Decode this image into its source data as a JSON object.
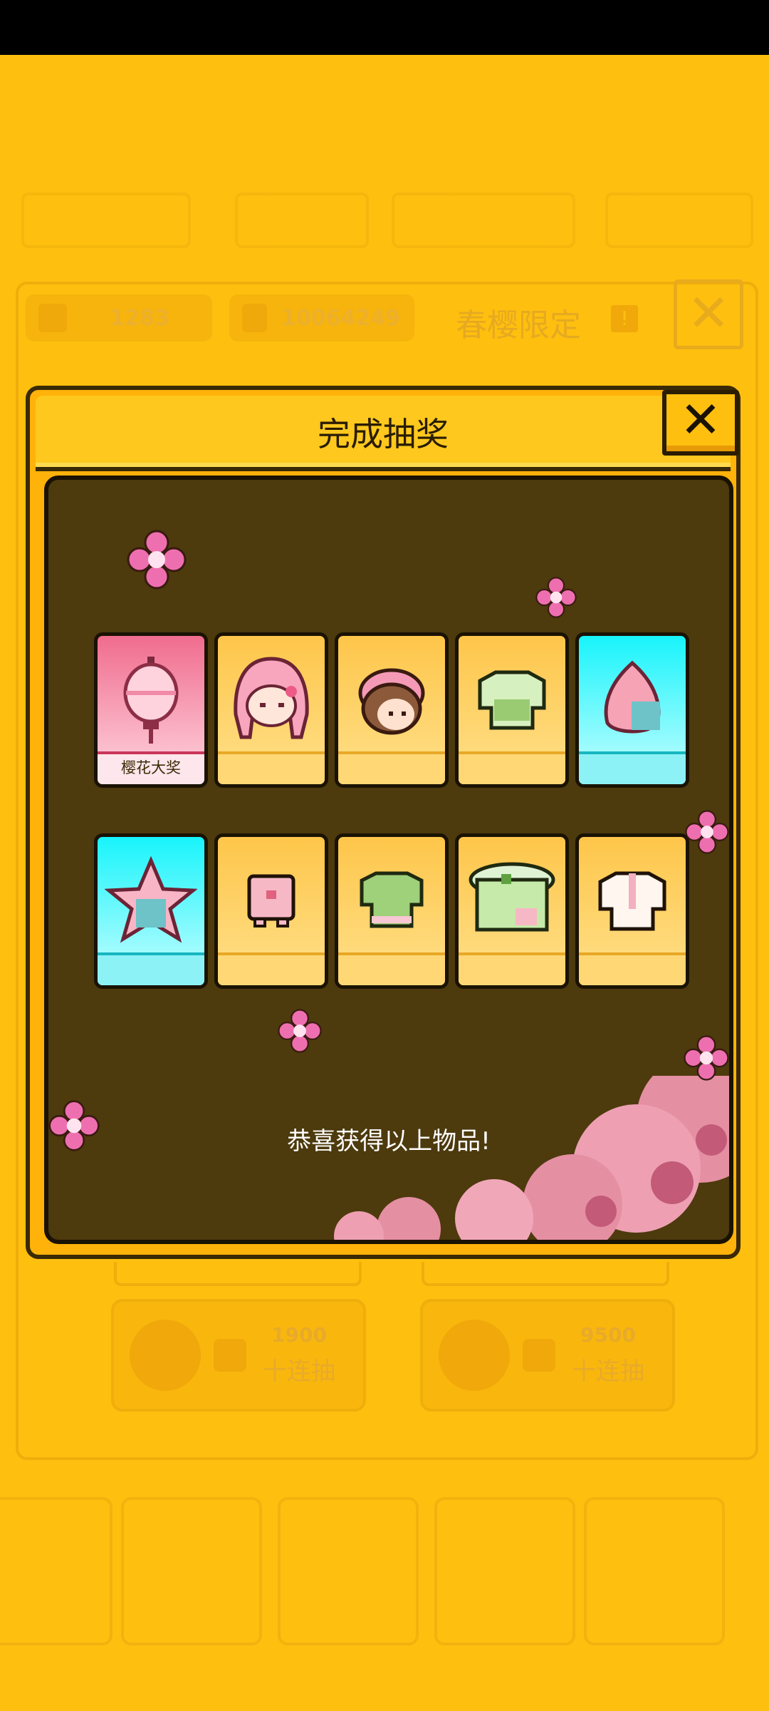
{
  "background": {
    "currency_gems": "1283",
    "currency_coins": "10064249",
    "event_title": "春樱限定",
    "buttons": [
      {
        "cost": "1900",
        "label": "十连抽"
      },
      {
        "cost": "9500",
        "label": "十连抽"
      }
    ]
  },
  "dialog": {
    "title": "完成抽奖",
    "close_glyph": "✕",
    "items": [
      {
        "name": "sakura-lantern",
        "rarity": "grand",
        "label": "樱花大奖"
      },
      {
        "name": "pink-hair-girl-head",
        "rarity": "common",
        "label": ""
      },
      {
        "name": "brown-hair-head",
        "rarity": "common",
        "label": ""
      },
      {
        "name": "green-shirt",
        "rarity": "common",
        "label": ""
      },
      {
        "name": "pink-petal-hood",
        "rarity": "rare",
        "label": ""
      },
      {
        "name": "star-blossom-outfit",
        "rarity": "rare",
        "label": ""
      },
      {
        "name": "pink-shirt",
        "rarity": "common",
        "label": ""
      },
      {
        "name": "green-tee",
        "rarity": "common",
        "label": ""
      },
      {
        "name": "matcha-cake-hat",
        "rarity": "common",
        "label": ""
      },
      {
        "name": "white-pink-shirt",
        "rarity": "common",
        "label": ""
      }
    ],
    "message": "恭喜获得以上物品!"
  },
  "colors": {
    "background": "#FEBF0F",
    "panel_dark": "#4D3A0D",
    "card_common": "#FEC64A",
    "card_rare": "#18F4FB",
    "card_grand": "#F06C8E",
    "blossom": "#EE6FB0"
  }
}
